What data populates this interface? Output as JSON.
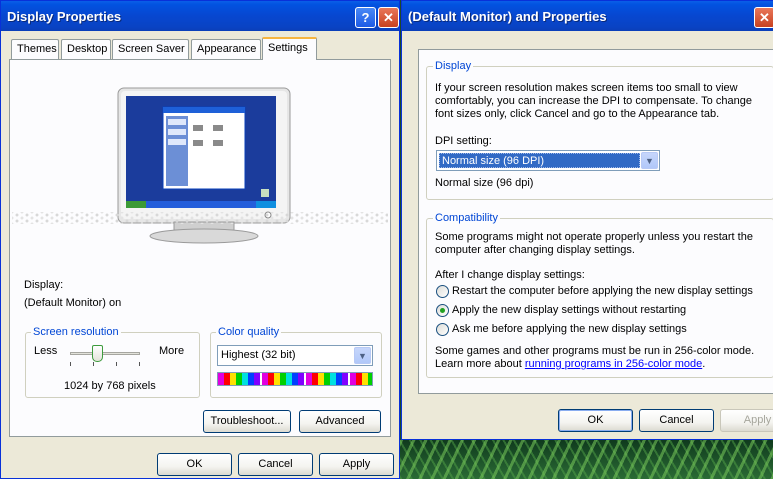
{
  "left_window": {
    "title": "Display Properties",
    "help_glyph": "?",
    "close_glyph": "✕",
    "tabs": [
      {
        "label": "Themes"
      },
      {
        "label": "Desktop"
      },
      {
        "label": "Screen Saver"
      },
      {
        "label": "Appearance"
      },
      {
        "label": "Settings"
      }
    ],
    "active_tab": "Settings",
    "display_label": "Display:",
    "display_value": "(Default Monitor) on",
    "screen_resolution": {
      "group_label": "Screen resolution",
      "less_label": "Less",
      "more_label": "More",
      "value_text": "1024 by 768 pixels",
      "slider_level_fraction": 0.38
    },
    "color_quality": {
      "group_label": "Color quality",
      "selected": "Highest (32 bit)"
    },
    "troubleshoot_label": "Troubleshoot...",
    "advanced_label": "Advanced",
    "ok_label": "OK",
    "cancel_label": "Cancel",
    "apply_label": "Apply"
  },
  "right_window": {
    "title": "(Default Monitor) and  Properties",
    "close_glyph": "✕",
    "display_group": {
      "label": "Display",
      "description_lines": [
        "If your screen resolution makes screen items too small to view",
        "comfortably, you can increase the DPI to compensate.  To change",
        "font sizes only, click Cancel and go to the Appearance tab."
      ],
      "dpi_label": "DPI setting:",
      "dpi_selected": "Normal size (96 DPI)",
      "dpi_value_text": "Normal size (96 dpi)"
    },
    "compatibility_group": {
      "label": "Compatibility",
      "description_lines": [
        "Some programs might not operate properly unless you restart the",
        "computer after changing display settings."
      ],
      "after_change_label": "After I change display settings:",
      "options": [
        {
          "label": "Restart the computer before applying the new display settings",
          "selected": false
        },
        {
          "label": "Apply the new display settings without restarting",
          "selected": true
        },
        {
          "label": "Ask me before applying the new display settings",
          "selected": false
        }
      ],
      "note_line1": "Some games and other programs must be run in 256-color mode.",
      "note_prefix": "Learn more about ",
      "note_link": "running programs in 256-color mode",
      "note_suffix": "."
    },
    "ok_label": "OK",
    "cancel_label": "Cancel",
    "apply_label": "Apply"
  },
  "colors": {
    "titlebar_blue": "#0747d0",
    "group_label_blue": "#0046d5",
    "window_face": "#ece9d8",
    "radio_selected": "#21a121"
  }
}
